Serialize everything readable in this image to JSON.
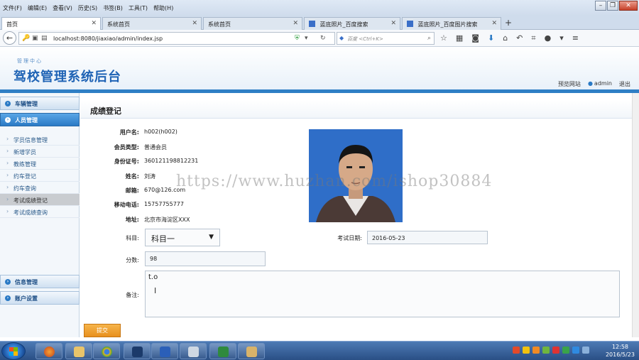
{
  "browser": {
    "menu": [
      "文件(F)",
      "编辑(E)",
      "查看(V)",
      "历史(S)",
      "书签(B)",
      "工具(T)",
      "帮助(H)"
    ],
    "tabs": [
      {
        "label": "首页",
        "active": true
      },
      {
        "label": "系统首页",
        "active": false
      },
      {
        "label": "系统首页",
        "active": false
      },
      {
        "label": "蓝底照片_百度搜索",
        "active": false
      },
      {
        "label": "蓝底照片_百度图片搜索",
        "active": false
      }
    ],
    "new_tab": "+",
    "url": "localhost:8080/jiaxiao/admin/index.jsp",
    "search_placeholder": "百度 <Ctrl+K>"
  },
  "app": {
    "subtitle": "管理中心",
    "title": "驾校管理系统后台",
    "user_bar": {
      "preview": "预览网站",
      "username": "admin",
      "logout": "退出"
    }
  },
  "sidebar": {
    "groups_top": [
      {
        "label": "车辆管理",
        "active": false
      },
      {
        "label": "人员管理",
        "active": true
      }
    ],
    "items": [
      {
        "label": "学员信息管理",
        "active": false
      },
      {
        "label": "新增学员",
        "active": false
      },
      {
        "label": "教练管理",
        "active": false
      },
      {
        "label": "约车登记",
        "active": false
      },
      {
        "label": "约车查询",
        "active": false
      },
      {
        "label": "考试成绩登记",
        "active": true
      },
      {
        "label": "考试成绩查询",
        "active": false
      }
    ],
    "groups_bottom": [
      {
        "label": "信息管理"
      },
      {
        "label": "账户设置"
      }
    ]
  },
  "main": {
    "title": "成绩登记",
    "fields": [
      {
        "label": "用户名:",
        "value": "h002(h002)"
      },
      {
        "label": "会员类型:",
        "value": "普通会员"
      },
      {
        "label": "身份证号:",
        "value": "360121198812231"
      },
      {
        "label": "姓名:",
        "value": "刘涛"
      },
      {
        "label": "邮箱:",
        "value": "670@126.com"
      },
      {
        "label": "移动电话:",
        "value": "15757755777"
      },
      {
        "label": "地址:",
        "value": "北京市海淀区XXX"
      }
    ],
    "subject_label": "科目:",
    "subject_value": "科目一",
    "exam_date_label": "考试日期:",
    "exam_date_value": "2016-05-23",
    "score_label": "分数:",
    "score_value": "98",
    "remark_label": "备注:",
    "remark_value": "t.o",
    "submit_label": "提交"
  },
  "watermark": "https://www.huzhan.com/ishop30884",
  "taskbar": {
    "time": "12:58",
    "date": "2016/5/23"
  },
  "colors": {
    "accent": "#2f7fc5",
    "title": "#1f63b5",
    "submit": "#e8901e",
    "photo_bg": "#2f6ec8"
  }
}
